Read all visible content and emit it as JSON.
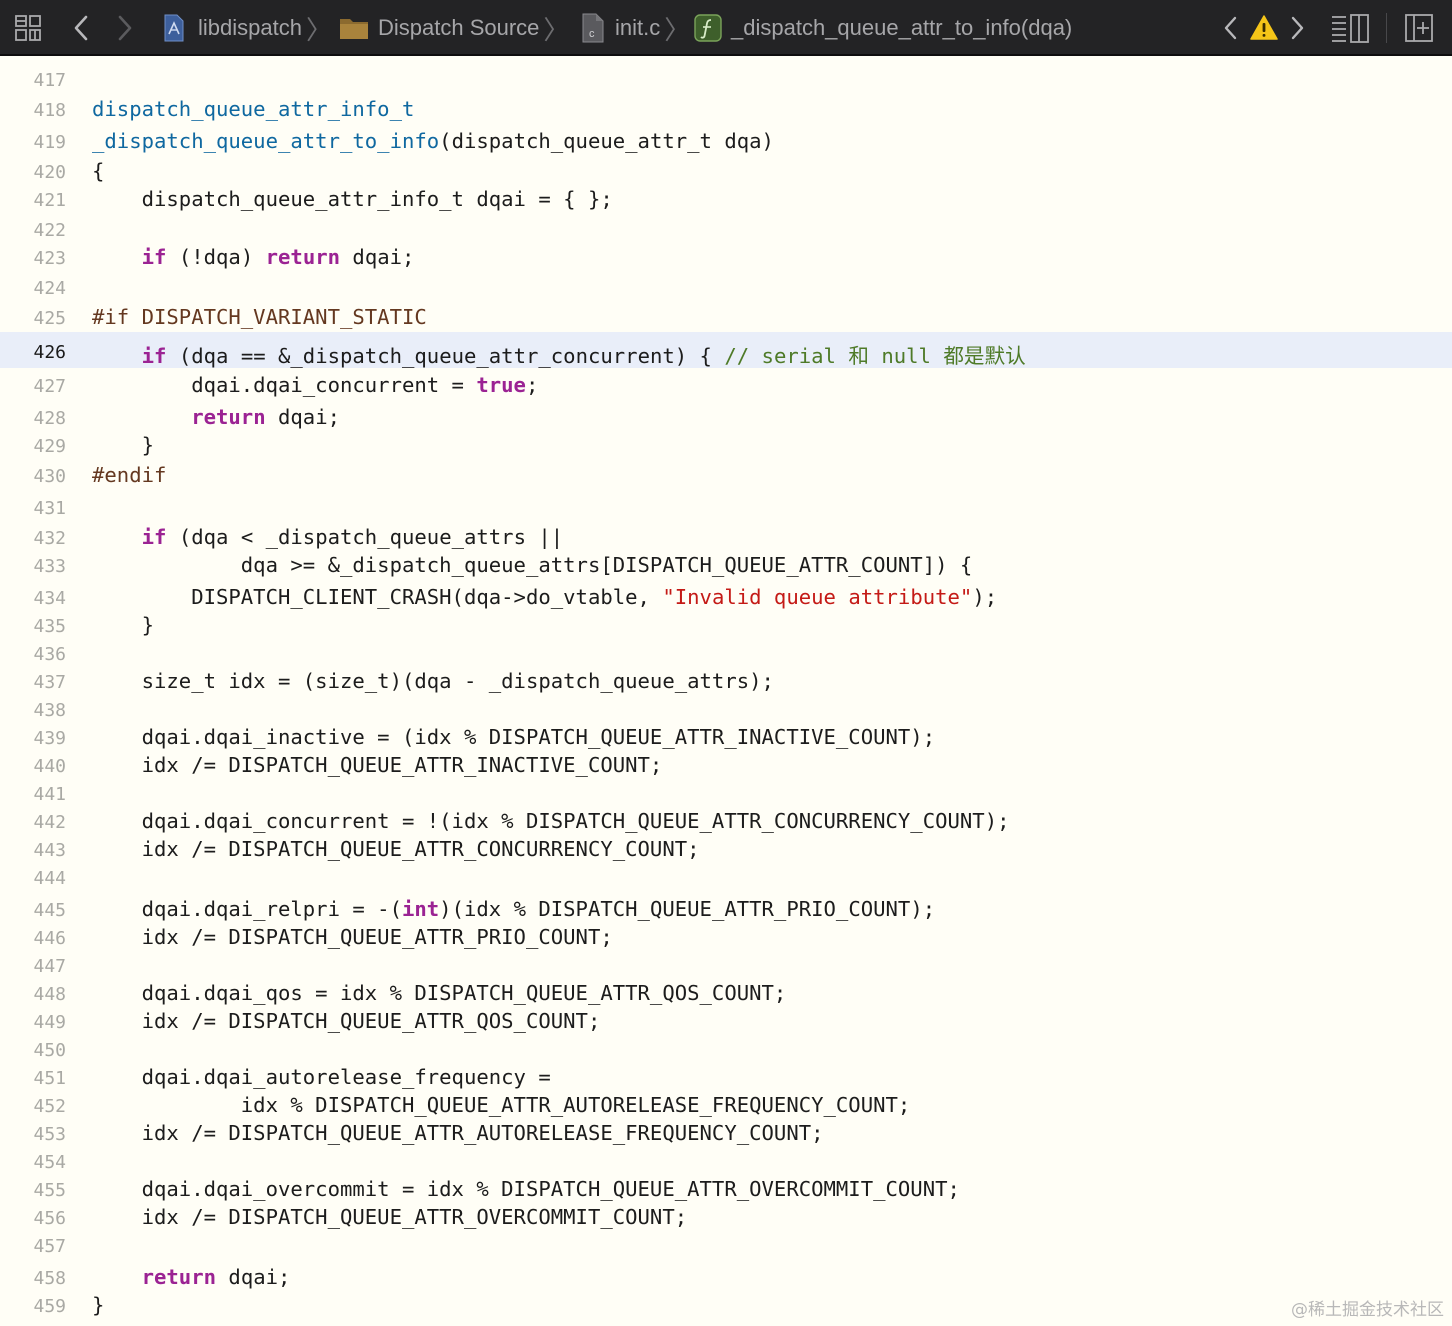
{
  "toolbar": {
    "breadcrumb": [
      {
        "label": "libdispatch",
        "icon": "xcode-project-icon"
      },
      {
        "label": "Dispatch Source",
        "icon": "folder-icon"
      },
      {
        "label": "init.c",
        "icon": "c-file-icon"
      },
      {
        "label": "_dispatch_queue_attr_to_info(dqa)",
        "icon": "function-icon"
      }
    ],
    "separator": "〉",
    "icons": [
      "related-items-grid-icon",
      "back-arrow-icon",
      "forward-arrow-icon",
      "previous-issue-icon",
      "warning-icon",
      "next-issue-icon",
      "editor-options-icon",
      "add-editor-icon"
    ],
    "colors": {
      "bar": "#232325",
      "warning": "#f5c518",
      "function_badge": "#5a8f3a"
    }
  },
  "editor": {
    "current_line": 426,
    "colors": {
      "keyword": "#9b2393",
      "function": "#0f68a0",
      "preprocessor": "#643820",
      "comment": "#4e7a28",
      "string": "#c41a16",
      "current_line_bg": "#e9eef9"
    },
    "lines": [
      {
        "n": "417",
        "t": []
      },
      {
        "n": "418",
        "t": [
          [
            "fn",
            "dispatch_queue_attr_info_t"
          ]
        ]
      },
      {
        "n": "419",
        "t": [
          [
            "fn",
            "_dispatch_queue_attr_to_info"
          ],
          [
            "p",
            "(dispatch_queue_attr_t dqa)"
          ]
        ]
      },
      {
        "n": "420",
        "t": [
          [
            "p",
            "{"
          ]
        ]
      },
      {
        "n": "421",
        "t": [
          [
            "p",
            "    dispatch_queue_attr_info_t dqai = { };"
          ]
        ]
      },
      {
        "n": "422",
        "t": []
      },
      {
        "n": "423",
        "t": [
          [
            "p",
            "    "
          ],
          [
            "kw",
            "if"
          ],
          [
            "p",
            " (!dqa) "
          ],
          [
            "kw",
            "return"
          ],
          [
            "p",
            " dqai;"
          ]
        ]
      },
      {
        "n": "424",
        "t": []
      },
      {
        "n": "425",
        "t": [
          [
            "pp",
            "#if DISPATCH_VARIANT_STATIC"
          ]
        ]
      },
      {
        "n": "426",
        "t": [
          [
            "p",
            "    "
          ],
          [
            "kw",
            "if"
          ],
          [
            "p",
            " (dqa == &_dispatch_queue_attr_concurrent) { "
          ],
          [
            "cm",
            "// serial 和 null 都是默认"
          ]
        ]
      },
      {
        "n": "427",
        "t": [
          [
            "p",
            "        dqai.dqai_concurrent = "
          ],
          [
            "kw",
            "true"
          ],
          [
            "p",
            ";"
          ]
        ]
      },
      {
        "n": "428",
        "t": [
          [
            "p",
            "        "
          ],
          [
            "kw",
            "return"
          ],
          [
            "p",
            " dqai;"
          ]
        ]
      },
      {
        "n": "429",
        "t": [
          [
            "p",
            "    }"
          ]
        ]
      },
      {
        "n": "430",
        "t": [
          [
            "pp",
            "#endif"
          ]
        ]
      },
      {
        "n": "431",
        "t": []
      },
      {
        "n": "432",
        "t": [
          [
            "p",
            "    "
          ],
          [
            "kw",
            "if"
          ],
          [
            "p",
            " (dqa < _dispatch_queue_attrs ||"
          ]
        ]
      },
      {
        "n": "433",
        "t": [
          [
            "p",
            "            dqa >= &_dispatch_queue_attrs[DISPATCH_QUEUE_ATTR_COUNT]) {"
          ]
        ]
      },
      {
        "n": "434",
        "t": [
          [
            "p",
            "        DISPATCH_CLIENT_CRASH(dqa->do_vtable, "
          ],
          [
            "str",
            "\"Invalid queue attribute\""
          ],
          [
            "p",
            ");"
          ]
        ]
      },
      {
        "n": "435",
        "t": [
          [
            "p",
            "    }"
          ]
        ]
      },
      {
        "n": "436",
        "t": []
      },
      {
        "n": "437",
        "t": [
          [
            "p",
            "    size_t idx = (size_t)(dqa - _dispatch_queue_attrs);"
          ]
        ]
      },
      {
        "n": "438",
        "t": []
      },
      {
        "n": "439",
        "t": [
          [
            "p",
            "    dqai.dqai_inactive = (idx % DISPATCH_QUEUE_ATTR_INACTIVE_COUNT);"
          ]
        ]
      },
      {
        "n": "440",
        "t": [
          [
            "p",
            "    idx /= DISPATCH_QUEUE_ATTR_INACTIVE_COUNT;"
          ]
        ]
      },
      {
        "n": "441",
        "t": []
      },
      {
        "n": "442",
        "t": [
          [
            "p",
            "    dqai.dqai_concurrent = !(idx % DISPATCH_QUEUE_ATTR_CONCURRENCY_COUNT);"
          ]
        ]
      },
      {
        "n": "443",
        "t": [
          [
            "p",
            "    idx /= DISPATCH_QUEUE_ATTR_CONCURRENCY_COUNT;"
          ]
        ]
      },
      {
        "n": "444",
        "t": []
      },
      {
        "n": "445",
        "t": [
          [
            "p",
            "    dqai.dqai_relpri = -("
          ],
          [
            "kw",
            "int"
          ],
          [
            "p",
            ")(idx % DISPATCH_QUEUE_ATTR_PRIO_COUNT);"
          ]
        ]
      },
      {
        "n": "446",
        "t": [
          [
            "p",
            "    idx /= DISPATCH_QUEUE_ATTR_PRIO_COUNT;"
          ]
        ]
      },
      {
        "n": "447",
        "t": []
      },
      {
        "n": "448",
        "t": [
          [
            "p",
            "    dqai.dqai_qos = idx % DISPATCH_QUEUE_ATTR_QOS_COUNT;"
          ]
        ]
      },
      {
        "n": "449",
        "t": [
          [
            "p",
            "    idx /= DISPATCH_QUEUE_ATTR_QOS_COUNT;"
          ]
        ]
      },
      {
        "n": "450",
        "t": []
      },
      {
        "n": "451",
        "t": [
          [
            "p",
            "    dqai.dqai_autorelease_frequency ="
          ]
        ]
      },
      {
        "n": "452",
        "t": [
          [
            "p",
            "            idx % DISPATCH_QUEUE_ATTR_AUTORELEASE_FREQUENCY_COUNT;"
          ]
        ]
      },
      {
        "n": "453",
        "t": [
          [
            "p",
            "    idx /= DISPATCH_QUEUE_ATTR_AUTORELEASE_FREQUENCY_COUNT;"
          ]
        ]
      },
      {
        "n": "454",
        "t": []
      },
      {
        "n": "455",
        "t": [
          [
            "p",
            "    dqai.dqai_overcommit = idx % DISPATCH_QUEUE_ATTR_OVERCOMMIT_COUNT;"
          ]
        ]
      },
      {
        "n": "456",
        "t": [
          [
            "p",
            "    idx /= DISPATCH_QUEUE_ATTR_OVERCOMMIT_COUNT;"
          ]
        ]
      },
      {
        "n": "457",
        "t": []
      },
      {
        "n": "458",
        "t": [
          [
            "p",
            "    "
          ],
          [
            "kw",
            "return"
          ],
          [
            "p",
            " dqai;"
          ]
        ]
      },
      {
        "n": "459",
        "t": [
          [
            "p",
            "}"
          ]
        ]
      }
    ]
  },
  "watermark": "@稀土掘金技术社区"
}
